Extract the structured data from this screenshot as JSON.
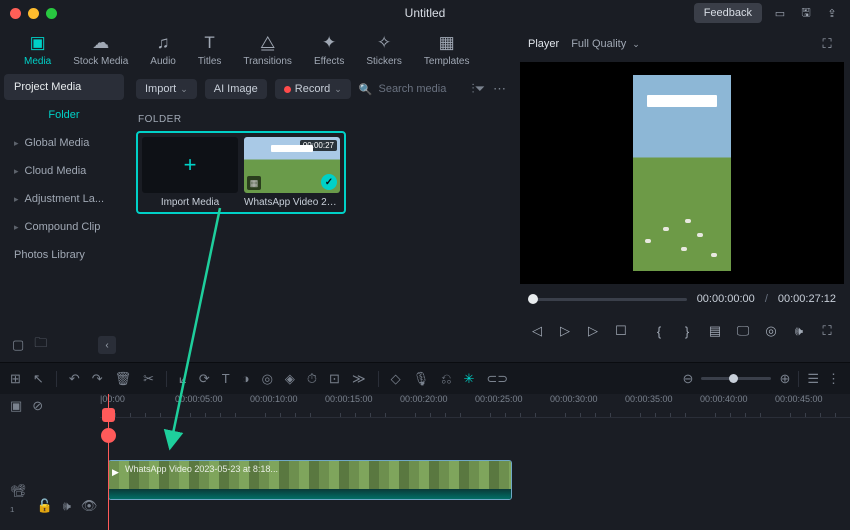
{
  "titlebar": {
    "title": "Untitled",
    "feedback": "Feedback"
  },
  "top_tabs": [
    {
      "label": "Media",
      "icon": "media"
    },
    {
      "label": "Stock Media",
      "icon": "stock"
    },
    {
      "label": "Audio",
      "icon": "audio"
    },
    {
      "label": "Titles",
      "icon": "titles"
    },
    {
      "label": "Transitions",
      "icon": "transitions"
    },
    {
      "label": "Effects",
      "icon": "effects"
    },
    {
      "label": "Stickers",
      "icon": "stickers"
    },
    {
      "label": "Templates",
      "icon": "templates"
    }
  ],
  "sidebar": {
    "items": [
      {
        "label": "Project Media",
        "style": "active-dark"
      },
      {
        "label": "Folder",
        "style": "active-green"
      },
      {
        "label": "Global Media",
        "chev": true
      },
      {
        "label": "Cloud Media",
        "chev": true
      },
      {
        "label": "Adjustment La...",
        "chev": true
      },
      {
        "label": "Compound Clip",
        "chev": true
      },
      {
        "label": "Photos Library"
      }
    ]
  },
  "content": {
    "import_btn": "Import",
    "ai_image_btn": "AI Image",
    "record_btn": "Record",
    "search_placeholder": "Search media",
    "folder_label": "FOLDER",
    "cards": [
      {
        "label": "Import Media",
        "type": "import"
      },
      {
        "label": "WhatsApp Video 202...",
        "type": "video",
        "duration": "00:00:27"
      }
    ]
  },
  "player": {
    "label": "Player",
    "quality": "Full Quality",
    "current_time": "00:00:00:00",
    "total_time": "00:00:27:12"
  },
  "timeline": {
    "markers": [
      "|00:00",
      "00:00:05:00",
      "00:00:10:00",
      "00:00:15:00",
      "00:00:20:00",
      "00:00:25:00",
      "00:00:30:00",
      "00:00:35:00",
      "00:00:40:00",
      "00:00:45:00"
    ],
    "clip_label": "WhatsApp Video 2023-05-23 at 8:18..."
  }
}
